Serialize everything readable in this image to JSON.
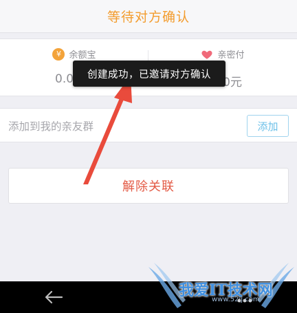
{
  "header": {
    "title": "等待对方确认"
  },
  "accounts": {
    "left": {
      "label": "余额宝",
      "icon": "coin-icon",
      "value": "0.0"
    },
    "right": {
      "label": "亲密付",
      "icon": "heart-icon",
      "value": "0元"
    }
  },
  "toast": {
    "message": "创建成功，已邀请对方确认"
  },
  "friend_group": {
    "label": "添加到我的亲友群",
    "button_label": "添加"
  },
  "unlink_button": {
    "label": "解除关联"
  },
  "watermark": {
    "main": "我爱IT技术网",
    "sub": "www.52ij.com"
  },
  "colors": {
    "title": "#f39c2e",
    "add_button": "#6cc0e8",
    "unlink_text": "#e35a45",
    "arrow": "#e94b3c",
    "background": "#efeff4"
  }
}
